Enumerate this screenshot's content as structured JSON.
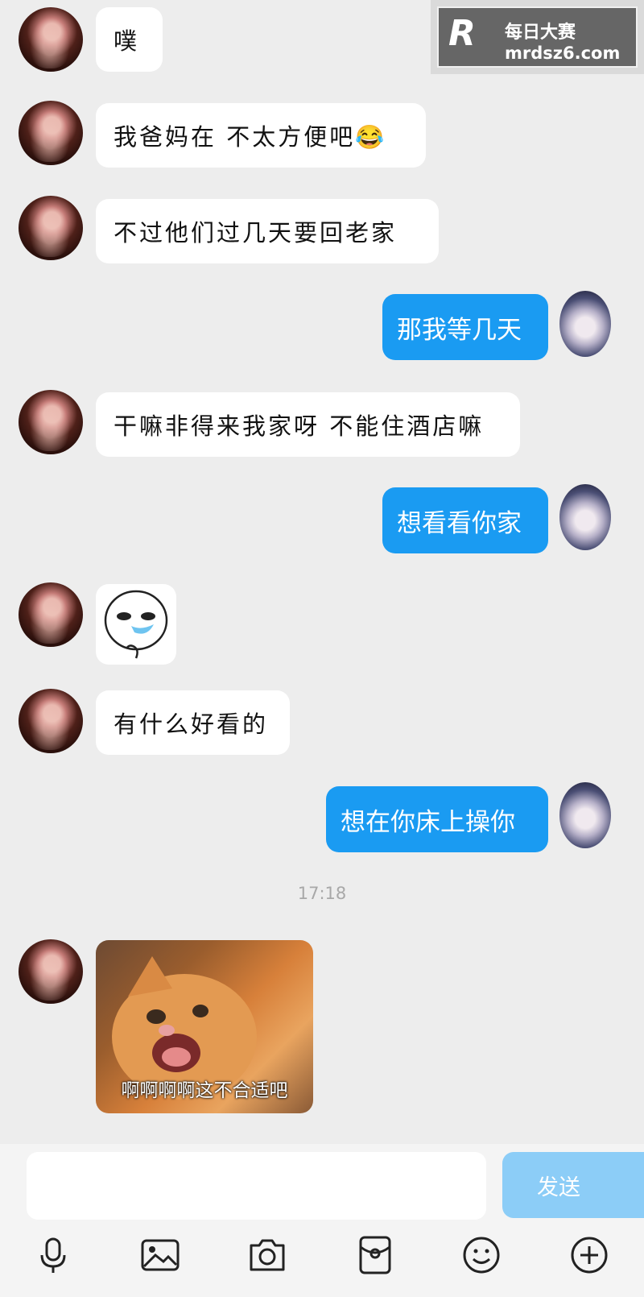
{
  "watermark": {
    "logo": "R",
    "name": "每日大赛",
    "url": "mrdsz6.com"
  },
  "messages": {
    "m1": "噗",
    "m2": "我爸妈在 不太方便吧😂",
    "m3": "不过他们过几天要回老家",
    "m4": "那我等几天",
    "m5": "干嘛非得来我家呀 不能住酒店嘛",
    "m6": "想看看你家",
    "m8": "有什么好看的",
    "m9": "想在你床上操你"
  },
  "timestamp": "17:18",
  "image_caption": "啊啊啊啊这不合适吧",
  "composer": {
    "input_placeholder": "",
    "send_label": "发送"
  },
  "icons": [
    "microphone-icon",
    "image-icon",
    "camera-icon",
    "red-packet-icon",
    "emoji-icon",
    "plus-icon"
  ]
}
